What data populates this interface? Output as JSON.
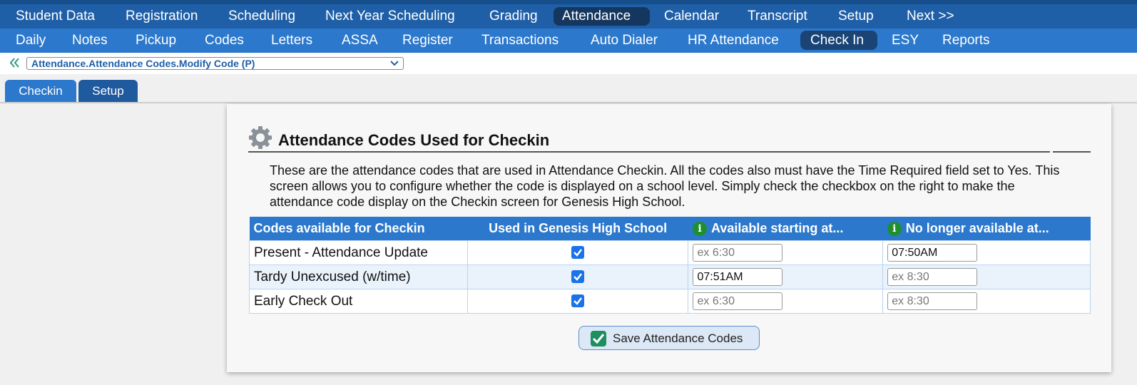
{
  "nav_top": [
    "Student Data",
    "Registration",
    "Scheduling",
    "Next Year Scheduling",
    "Grading",
    "Attendance",
    "Calendar",
    "Transcript",
    "Setup",
    "Next >>"
  ],
  "nav_top_active": "Attendance",
  "nav_sub": [
    "Daily",
    "Notes",
    "Pickup",
    "Codes",
    "Letters",
    "ASSA",
    "Register",
    "Transactions",
    "Auto Dialer",
    "HR Attendance",
    "Check In",
    "ESY",
    "Reports"
  ],
  "nav_sub_active": "Check In",
  "breadcrumb": "Attendance.Attendance Codes.Modify Code (P)",
  "subtabs": [
    "Checkin",
    "Setup"
  ],
  "panel": {
    "title": "Attendance Codes Used for Checkin",
    "description": "These are the attendance codes that are used in Attendance Checkin. All the codes also must have the Time Required field set to Yes. This screen allows you to configure whether the code is displayed on a school level. Simply check the checkbox on the right to make the attendance code display on the Checkin screen for Genesis High School."
  },
  "table": {
    "headers": [
      "Codes available for Checkin",
      "Used in Genesis High School",
      "Available starting at...",
      "No longer available at..."
    ],
    "rows": [
      {
        "code": "Present - Attendance Update",
        "used": true,
        "start": "",
        "start_placeholder": "ex 6:30",
        "end": "07:50AM",
        "end_placeholder": "ex 8:30"
      },
      {
        "code": "Tardy Unexcused (w/time)",
        "used": true,
        "start": "07:51AM",
        "start_placeholder": "ex 6:30",
        "end": "",
        "end_placeholder": "ex 8:30"
      },
      {
        "code": "Early Check Out",
        "used": true,
        "start": "",
        "start_placeholder": "ex 6:30",
        "end": "",
        "end_placeholder": "ex 8:30"
      }
    ]
  },
  "save_label": "Save Attendance Codes",
  "colors": {
    "nav_top": "#1f5fa7",
    "nav_sub": "#2c78cc",
    "active": "#15365f",
    "info": "#1e8f2e"
  }
}
